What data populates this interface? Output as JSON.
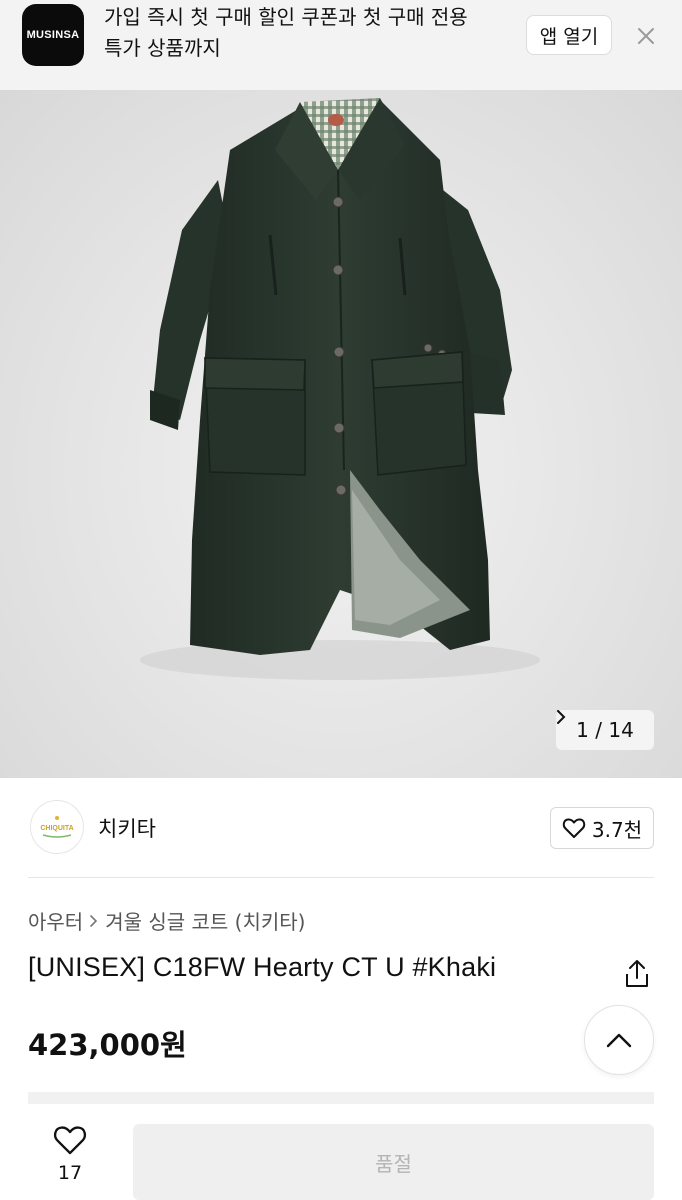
{
  "banner": {
    "logo_text": "MUSINSA",
    "message_line1": "가입 즉시 첫 구매 할인 쿠폰과 첫 구매 전용",
    "message_line2": "특가 상품까지",
    "open_app_label": "앱 열기",
    "close_icon": "close-icon"
  },
  "gallery": {
    "pager_text": "1 / 14",
    "next_icon": "chevron-right-icon",
    "coat_color": "#2c3a30"
  },
  "brand": {
    "name": "치키타",
    "logo_text": "CHIQUITA",
    "like_icon": "heart-outline-icon",
    "like_count": "3.7천"
  },
  "product": {
    "breadcrumb": [
      "아우터",
      "겨울 싱글 코트 (치키타)"
    ],
    "title": "[UNISEX] C18FW Hearty CT U #Khaki",
    "price": "423,000원",
    "share_icon": "share-icon",
    "scroll_top_icon": "chevron-up-icon"
  },
  "bottom_bar": {
    "wish_icon": "heart-outline-icon",
    "wish_count": "17",
    "buy_label": "품절"
  }
}
